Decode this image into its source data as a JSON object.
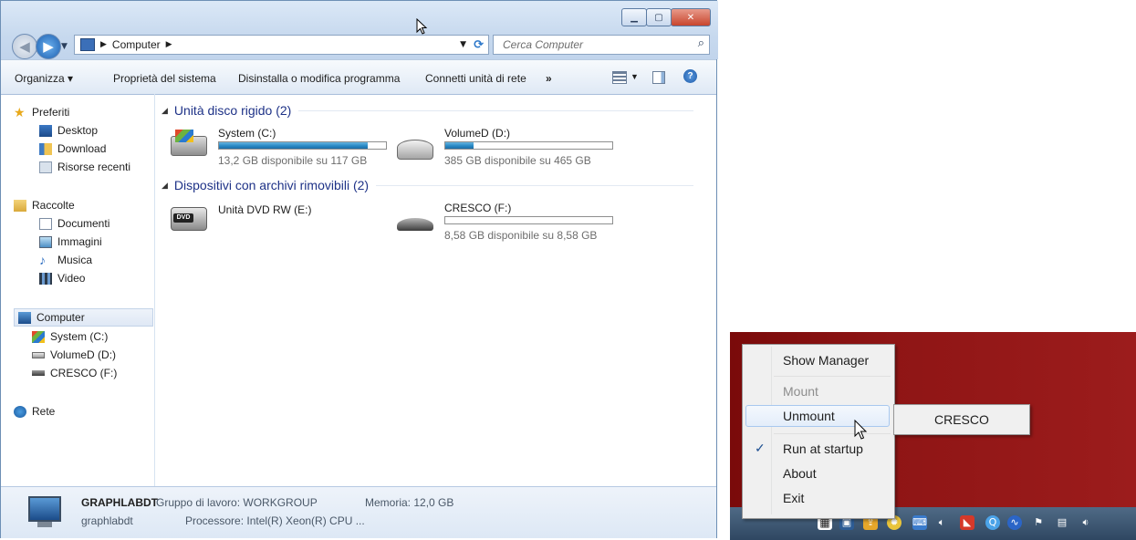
{
  "explorer": {
    "address": {
      "crumb": "Computer"
    },
    "search": {
      "placeholder": "Cerca Computer"
    },
    "toolbar": {
      "organize": "Organizza ▾",
      "system_properties": "Proprietà del sistema",
      "uninstall": "Disinstalla o modifica programma",
      "map_drive": "Connetti unità di rete",
      "more": "»"
    },
    "nav": {
      "favorites": "Preferiti",
      "desktop": "Desktop",
      "download": "Download",
      "recent": "Risorse recenti",
      "libraries": "Raccolte",
      "documents": "Documenti",
      "pictures": "Immagini",
      "music": "Musica",
      "video": "Video",
      "computer": "Computer",
      "system_c": "System (C:)",
      "volume_d": "VolumeD (D:)",
      "cresco_f": "CRESCO (F:)",
      "network": "Rete"
    },
    "groups": {
      "hdd": "Unità disco rigido (2)",
      "removable": "Dispositivi con archivi rimovibili (2)"
    },
    "drives": {
      "c": {
        "name": "System (C:)",
        "free": "13,2 GB disponibile su 117 GB",
        "used_fraction": 0.89
      },
      "d": {
        "name": "VolumeD (D:)",
        "free": "385 GB disponibile su 465 GB",
        "used_fraction": 0.17
      },
      "dvd": {
        "name": "Unità DVD RW (E:)"
      },
      "f": {
        "name": "CRESCO (F:)",
        "free": "8,58 GB disponibile su 8,58 GB",
        "used_fraction": 0.0
      }
    },
    "details": {
      "name": "GRAPHLABDT",
      "workgroup": "Gruppo di lavoro: WORKGROUP",
      "memory": "Memoria: 12,0 GB",
      "user": "graphlabdt",
      "processor": "Processore: Intel(R) Xeon(R) CPU   ..."
    }
  },
  "tray_menu": {
    "show_manager": "Show Manager",
    "mount": "Mount",
    "unmount": "Unmount",
    "run_at_startup": "Run at startup",
    "about": "About",
    "exit": "Exit",
    "check": "✓",
    "submenu_item": "CRESCO"
  },
  "colors": {
    "accent": "#1e3287",
    "desktop": "#8f1515",
    "bar_fill": "#2a8ac5"
  }
}
